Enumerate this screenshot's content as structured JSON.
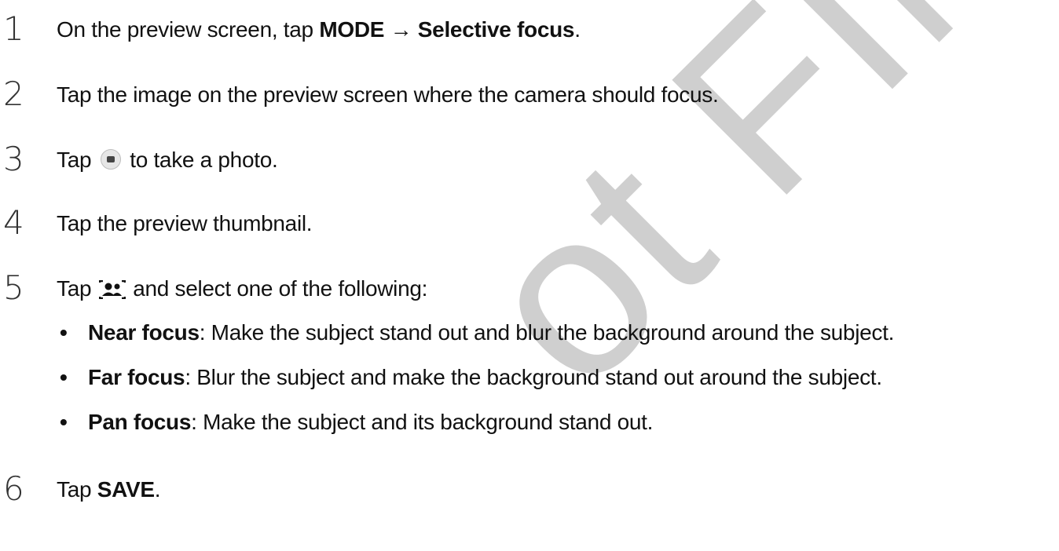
{
  "watermark": "ot FINAL",
  "steps": [
    {
      "num": "1",
      "pre": "On the preview screen, tap ",
      "b1": "MODE",
      "mid": " → ",
      "b2": "Selective focus",
      "post": "."
    },
    {
      "num": "2",
      "text": "Tap the image on the preview screen where the camera should focus."
    },
    {
      "num": "3",
      "pre": "Tap ",
      "post": " to take a photo.",
      "icon": "camera-shutter-icon"
    },
    {
      "num": "4",
      "text": "Tap the preview thumbnail."
    },
    {
      "num": "5",
      "pre": "Tap ",
      "post": " and select one of the following:",
      "icon": "selective-focus-faces-icon"
    },
    {
      "num": "6",
      "pre": "Tap ",
      "b1": "SAVE",
      "post": "."
    }
  ],
  "options": [
    {
      "bullet": "•",
      "term": "Near focus",
      "desc": ": Make the subject stand out and blur the background around the subject."
    },
    {
      "bullet": "•",
      "term": "Far focus",
      "desc": ": Blur the subject and make the background stand out around the subject."
    },
    {
      "bullet": "•",
      "term": "Pan focus",
      "desc": ": Make the subject and its background stand out."
    }
  ]
}
